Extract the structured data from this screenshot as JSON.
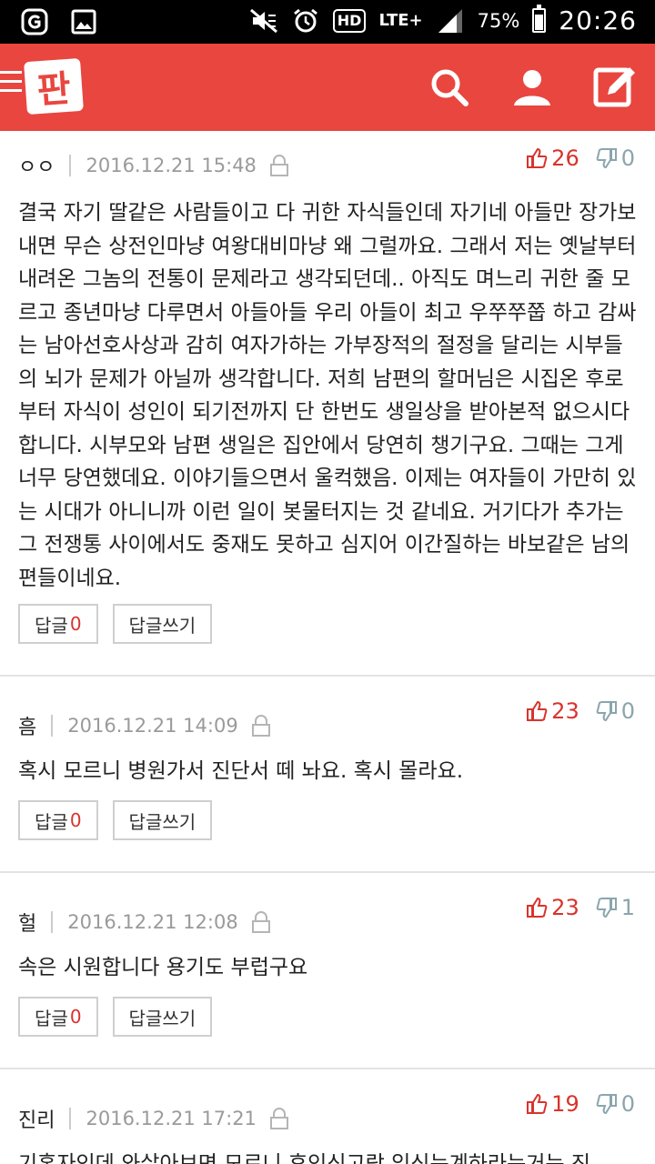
{
  "status_bar": {
    "battery": "75%",
    "time": "20:26",
    "network": "LTE+",
    "hd": "HD"
  },
  "app": {
    "logo_text": "판",
    "brand_color": "#e8463f"
  },
  "icons": {
    "search": "search-icon",
    "profile": "user-icon",
    "write": "edit-icon"
  },
  "comments": [
    {
      "author": "ㅇㅇ",
      "date": "2016.12.21 15:48",
      "up": "26",
      "down": "0",
      "text": "결국 자기 딸같은 사람들이고 다 귀한 자식들인데 자기네 아들만 장가보내면 무슨 상전인마냥 여왕대비마냥 왜 그럴까요. 그래서 저는 옛날부터 내려온 그놈의 전통이 문제라고 생각되던데.. 아직도 며느리 귀한 줄 모르고 종년마냥 다루면서 아들아들 우리 아들이 최고 우쭈쭈쭙 하고 감싸는 남아선호사상과 감히 여자가하는 가부장적의 절정을 달리는 시부들의 뇌가 문제가 아닐까 생각합니다. 저희 남편의 할머님은 시집온 후로부터 자식이 성인이 되기전까지 단 한번도 생일상을 받아본적 없으시다합니다. 시부모와 남편 생일은 집안에서 당연히 챙기구요. 그때는 그게 너무 당연했데요. 이야기들으면서 울컥했음. 이제는 여자들이 가만히 있는 시대가 아니니까 이런 일이 봇물터지는 것 같네요. 거기다가 추가는 그 전쟁통 사이에서도 중재도 못하고 심지어 이간질하는 바보같은 남의편들이네요.",
      "reply_label": "답글",
      "reply_count": "0",
      "write_label": "답글쓰기"
    },
    {
      "author": "흠",
      "date": "2016.12.21 14:09",
      "up": "23",
      "down": "0",
      "text": "혹시 모르니 병원가서 진단서 떼 놔요. 혹시 몰라요.",
      "reply_label": "답글",
      "reply_count": "0",
      "write_label": "답글쓰기"
    },
    {
      "author": "헐",
      "date": "2016.12.21 12:08",
      "up": "23",
      "down": "1",
      "text": "속은 시원합니다 용기도 부럽구요",
      "reply_label": "답글",
      "reply_count": "0",
      "write_label": "답글쓰기"
    },
    {
      "author": "진리",
      "date": "2016.12.21 17:21",
      "up": "19",
      "down": "0",
      "text": "기혼자인데 와살아보면 모르니 후인신고랑 임신는계하라는거는 진"
    }
  ]
}
